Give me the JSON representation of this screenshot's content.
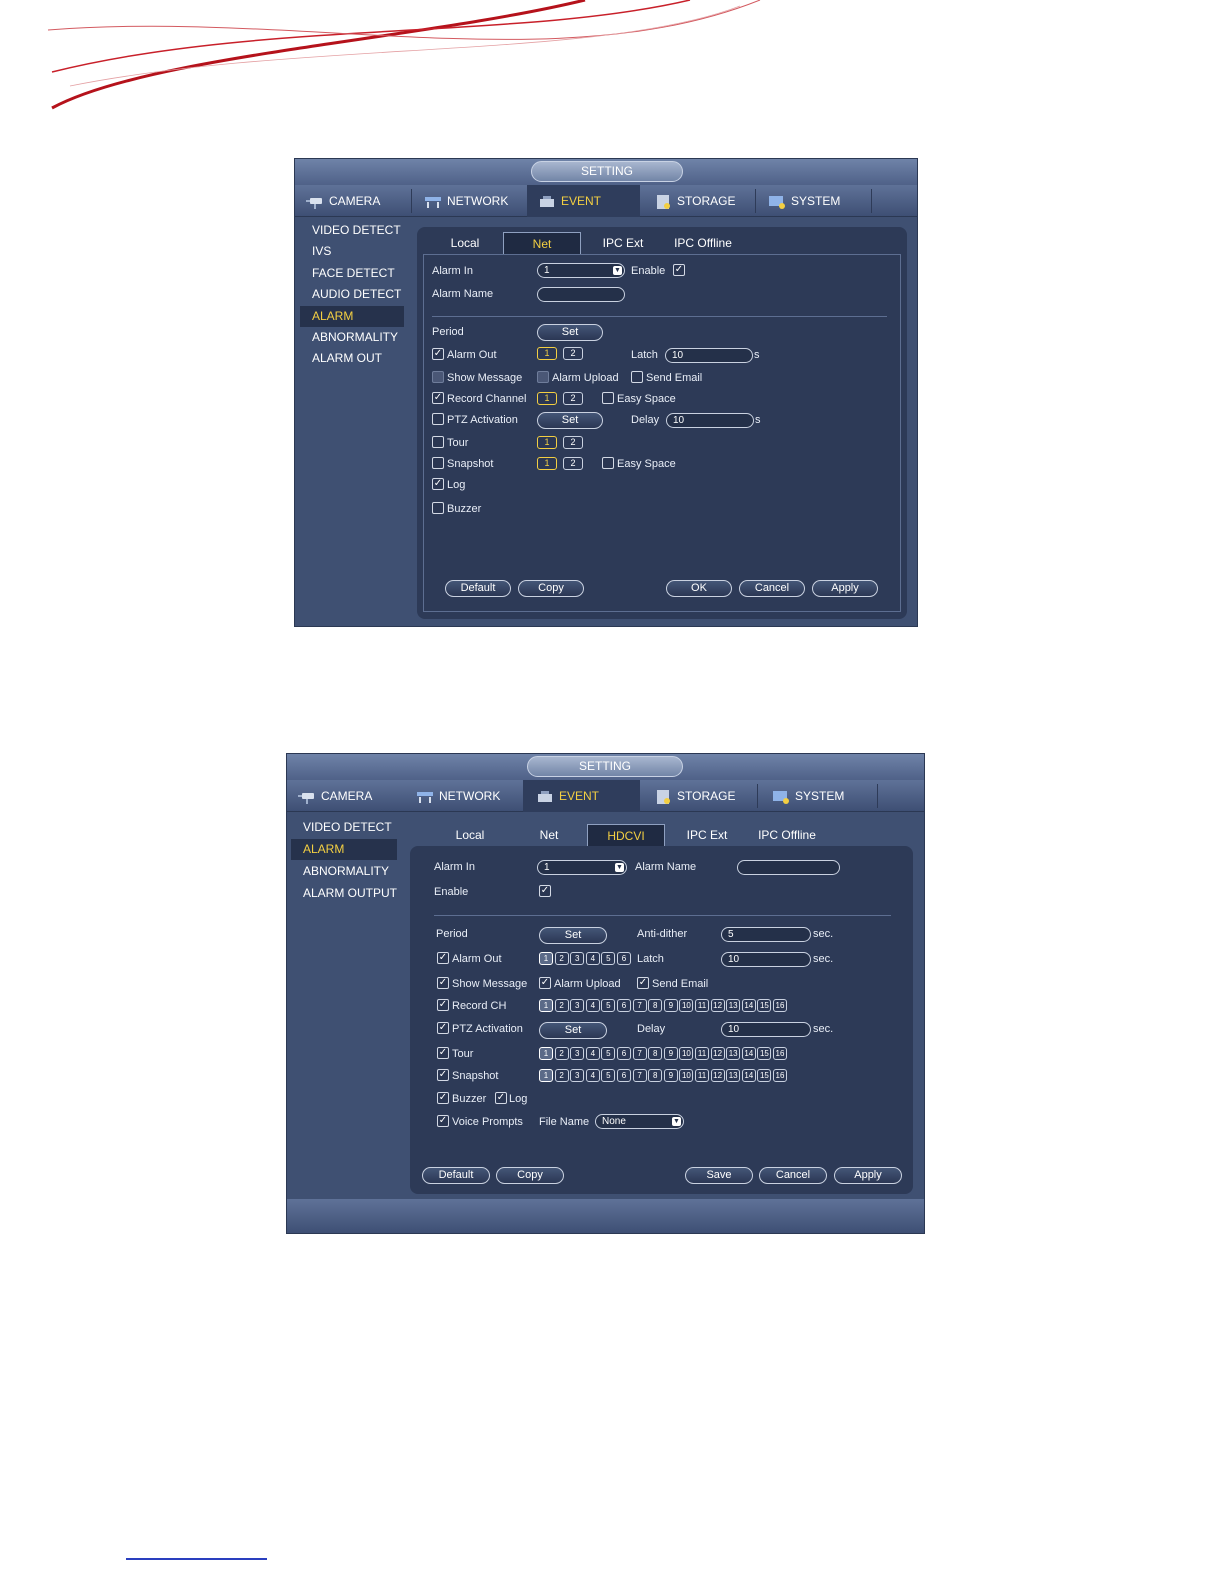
{
  "screens": [
    {
      "title": "SETTING",
      "menu": [
        "CAMERA",
        "NETWORK",
        "EVENT",
        "STORAGE",
        "SYSTEM"
      ],
      "active_menu": "EVENT",
      "sidebar": [
        "VIDEO DETECT",
        "IVS",
        "FACE DETECT",
        "AUDIO DETECT",
        "ALARM",
        "ABNORMALITY",
        "ALARM OUT"
      ],
      "active_sidebar": "ALARM",
      "tabs": [
        "Local",
        "Net",
        "IPC Ext",
        "IPC Offline"
      ],
      "active_tab": "Net",
      "form": {
        "alarm_in_label": "Alarm In",
        "alarm_in_value": "1",
        "enable_label": "Enable",
        "alarm_name_label": "Alarm Name",
        "period_label": "Period",
        "set_label": "Set",
        "alarm_out_label": "Alarm Out",
        "latch_label": "Latch",
        "latch_value": "10",
        "unit_s": "s",
        "show_message_label": "Show Message",
        "alarm_upload_label": "Alarm Upload",
        "send_email_label": "Send Email",
        "record_channel_label": "Record Channel",
        "easy_space_label": "Easy Space",
        "ptz_activation_label": "PTZ Activation",
        "delay_label": "Delay",
        "delay_value": "10",
        "tour_label": "Tour",
        "snapshot_label": "Snapshot",
        "log_label": "Log",
        "buzzer_label": "Buzzer",
        "channels": [
          "1",
          "2"
        ]
      },
      "buttons": {
        "default": "Default",
        "copy": "Copy",
        "ok": "OK",
        "cancel": "Cancel",
        "apply": "Apply"
      }
    },
    {
      "title": "SETTING",
      "menu": [
        "CAMERA",
        "NETWORK",
        "EVENT",
        "STORAGE",
        "SYSTEM"
      ],
      "active_menu": "EVENT",
      "sidebar": [
        "VIDEO DETECT",
        "ALARM",
        "ABNORMALITY",
        "ALARM OUTPUT"
      ],
      "active_sidebar": "ALARM",
      "tabs": [
        "Local",
        "Net",
        "HDCVI",
        "IPC Ext",
        "IPC Offline"
      ],
      "active_tab": "HDCVI",
      "form": {
        "alarm_in_label": "Alarm In",
        "alarm_in_value": "1",
        "alarm_name_label": "Alarm Name",
        "enable_label": "Enable",
        "period_label": "Period",
        "set_label": "Set",
        "anti_dither_label": "Anti-dither",
        "anti_dither_value": "5",
        "unit_sec": "sec.",
        "alarm_out_label": "Alarm Out",
        "latch_label": "Latch",
        "latch_value": "10",
        "show_message_label": "Show Message",
        "alarm_upload_label": "Alarm Upload",
        "send_email_label": "Send Email",
        "record_ch_label": "Record CH",
        "ptz_activation_label": "PTZ Activation",
        "delay_label": "Delay",
        "delay_value": "10",
        "tour_label": "Tour",
        "snapshot_label": "Snapshot",
        "buzzer_label": "Buzzer",
        "log_label": "Log",
        "voice_prompts_label": "Voice Prompts",
        "file_name_label": "File Name",
        "file_name_value": "None",
        "alarm_out_channels": [
          "1",
          "2",
          "3",
          "4",
          "5",
          "6"
        ],
        "channels16": [
          "1",
          "2",
          "3",
          "4",
          "5",
          "6",
          "7",
          "8",
          "9",
          "10",
          "11",
          "12",
          "13",
          "14",
          "15",
          "16"
        ]
      },
      "buttons": {
        "default": "Default",
        "copy": "Copy",
        "save": "Save",
        "cancel": "Cancel",
        "apply": "Apply"
      }
    }
  ]
}
